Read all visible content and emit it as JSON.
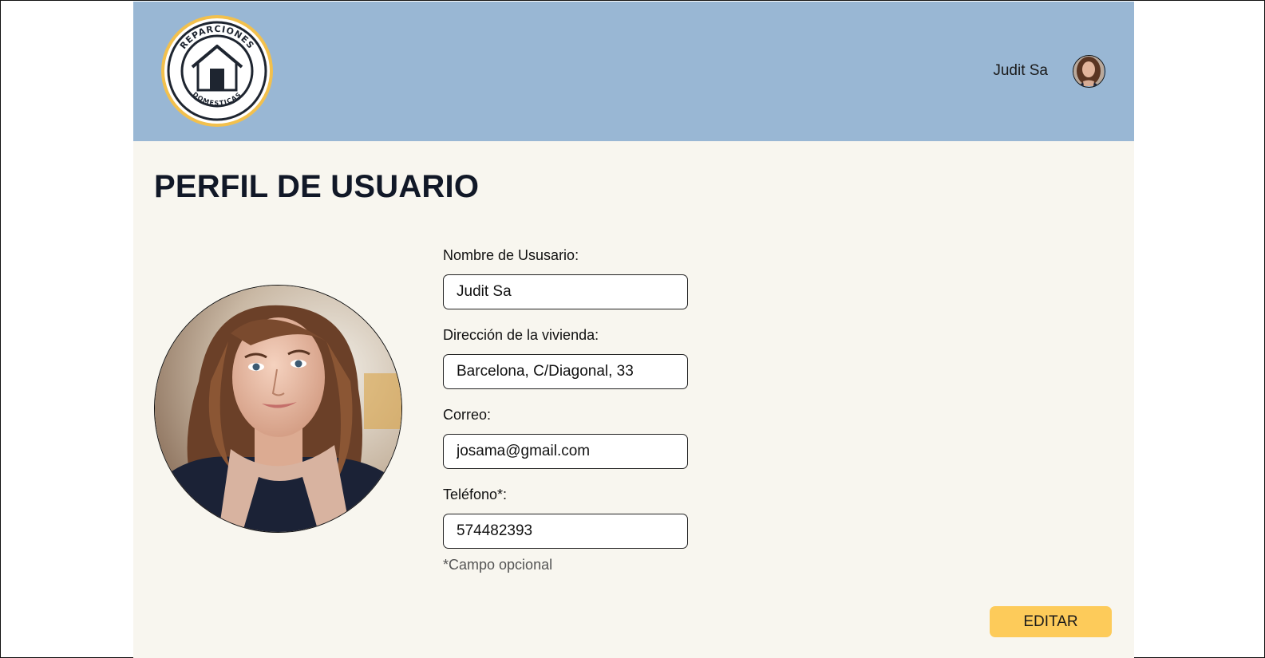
{
  "header": {
    "logo_top_text": "REPARCIONES",
    "logo_bottom_text": "DOMESTICAS",
    "user_name": "Judit Sa"
  },
  "main": {
    "title": "PERFIL DE USUARIO",
    "fields": [
      {
        "label": "Nombre de Ususario:",
        "value": "Judit Sa"
      },
      {
        "label": "Dirección de la vivienda:",
        "value": "Barcelona, C/Diagonal, 33"
      },
      {
        "label": "Correo:",
        "value": "josama@gmail.com"
      },
      {
        "label": "Teléfono*:",
        "value": "574482393"
      }
    ],
    "note": "*Campo opcional",
    "edit_label": "EDITAR"
  },
  "colors": {
    "header_bg": "#99b7d4",
    "page_bg": "#f8f6ef",
    "accent": "#fdcb5a",
    "logo_ring": "#f2c04d"
  }
}
